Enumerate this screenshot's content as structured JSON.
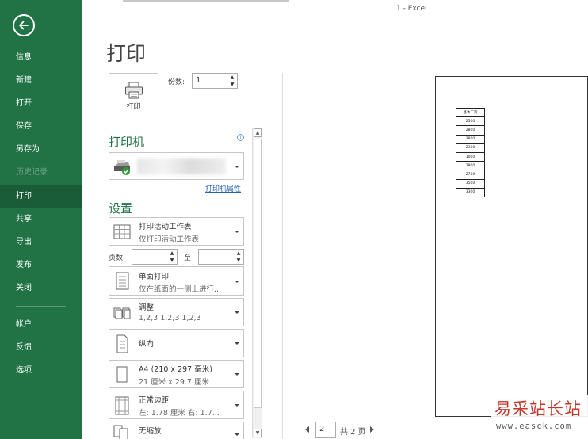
{
  "window_title": "1  -  Excel",
  "sidebar": {
    "items": [
      {
        "label": "信息"
      },
      {
        "label": "新建"
      },
      {
        "label": "打开"
      },
      {
        "label": "保存"
      },
      {
        "label": "另存为"
      },
      {
        "label": "历史记录"
      },
      {
        "label": "打印"
      },
      {
        "label": "共享"
      },
      {
        "label": "导出"
      },
      {
        "label": "发布"
      },
      {
        "label": "关闭"
      },
      {
        "label": "帐户"
      },
      {
        "label": "反馈"
      },
      {
        "label": "选项"
      }
    ],
    "active": "打印",
    "accent_color": "#217346"
  },
  "page_title": "打印",
  "print_button": {
    "label": "打印"
  },
  "copies": {
    "label": "份数:",
    "value": "1"
  },
  "printer": {
    "section_title": "打印机",
    "info_icon": "i",
    "properties_link": "打印机属性"
  },
  "settings": {
    "section_title": "设置",
    "what_to_print": {
      "main": "打印活动工作表",
      "sub": "仅打印活动工作表"
    },
    "pages": {
      "label": "页数:",
      "to_label": "至",
      "from_value": "",
      "to_value": ""
    },
    "sides": {
      "main": "单面打印",
      "sub": "仅在纸面的一侧上进行..."
    },
    "collation": {
      "main": "调整",
      "sub": "1,2,3    1,2,3    1,2,3"
    },
    "orientation": {
      "main": "纵向"
    },
    "paper": {
      "main": "A4 (210 x 297 毫米)",
      "sub": "21 厘米 x 29.7 厘米"
    },
    "margins": {
      "main": "正常边距",
      "sub": "左: 1.78 厘米    右: 1.7..."
    },
    "scaling": {
      "main": "无缩放"
    }
  },
  "preview": {
    "table_header": "基本工资",
    "table_values": [
      "2500",
      "2800",
      "3800",
      "2300",
      "1000",
      "2800",
      "2700",
      "3500",
      "3300"
    ]
  },
  "page_nav": {
    "current": "2",
    "total": "共 2 页"
  },
  "watermark": {
    "cn": "易采站长站",
    "en": "www.easck.com"
  }
}
